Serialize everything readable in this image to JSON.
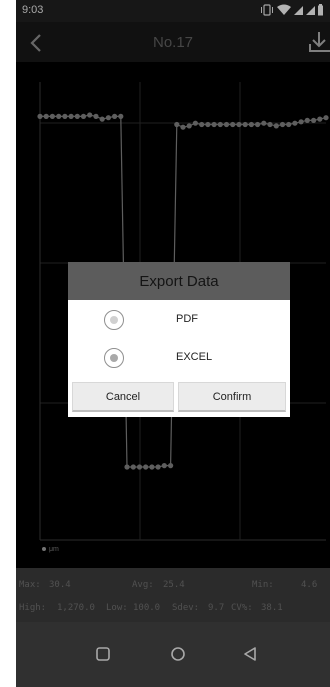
{
  "status_bar": {
    "time": "9:03",
    "icons": [
      "vibrate-icon",
      "wifi-icon",
      "cell-signal-icon",
      "cell-signal-icon",
      "battery-icon"
    ]
  },
  "header": {
    "title": "No.17",
    "back_icon": "chevron-left-icon",
    "action_icon": "download-icon"
  },
  "chart": {
    "legend": "μm",
    "colors": {
      "series": "#7e7e7e",
      "grid": "#2b2b2b",
      "axis": "#3a3a3a"
    }
  },
  "chart_data": {
    "type": "line",
    "title": "",
    "xlabel": "",
    "ylabel": "",
    "series": [
      {
        "name": "μm",
        "points": [
          [
            1,
            30.4
          ],
          [
            2,
            30.4
          ],
          [
            3,
            30.4
          ],
          [
            4,
            30.4
          ],
          [
            5,
            30.4
          ],
          [
            6,
            30.4
          ],
          [
            7,
            30.4
          ],
          [
            8,
            30.4
          ],
          [
            9,
            30.5
          ],
          [
            10,
            30.4
          ],
          [
            11,
            30.2
          ],
          [
            12,
            30.3
          ],
          [
            13,
            30.4
          ],
          [
            14,
            30.4
          ],
          [
            15,
            4.6
          ],
          [
            16,
            4.6
          ],
          [
            17,
            4.6
          ],
          [
            18,
            4.6
          ],
          [
            19,
            4.6
          ],
          [
            20,
            4.6
          ],
          [
            21,
            4.7
          ],
          [
            22,
            4.7
          ],
          [
            23,
            29.8
          ],
          [
            24,
            29.6
          ],
          [
            25,
            29.7
          ],
          [
            26,
            29.9
          ],
          [
            27,
            29.8
          ],
          [
            28,
            29.8
          ],
          [
            29,
            29.8
          ],
          [
            30,
            29.8
          ],
          [
            31,
            29.8
          ],
          [
            32,
            29.8
          ],
          [
            33,
            29.8
          ],
          [
            34,
            29.8
          ],
          [
            35,
            29.8
          ],
          [
            36,
            29.8
          ],
          [
            37,
            29.9
          ],
          [
            38,
            29.8
          ],
          [
            39,
            29.7
          ],
          [
            40,
            29.8
          ],
          [
            41,
            29.8
          ],
          [
            42,
            29.9
          ],
          [
            43,
            30.0
          ],
          [
            44,
            30.1
          ],
          [
            45,
            30.1
          ],
          [
            46,
            30.2
          ],
          [
            47,
            30.3
          ]
        ]
      }
    ]
  },
  "stats": {
    "max_label": "Max:",
    "max_value": "30.4",
    "avg_label": "Avg:",
    "avg_value": "25.4",
    "min_label": "Min:",
    "min_value": "4.6",
    "high_label": "High:",
    "high_value": "1,270.0",
    "low_label": "Low:",
    "low_value": "100.0",
    "sdev_label": "Sdev:",
    "sdev_value": "9.7",
    "cv_label": "CV%:",
    "cv_value": "38.1"
  },
  "dialog": {
    "title": "Export Data",
    "options": [
      {
        "label": "PDF",
        "selected": false
      },
      {
        "label": "EXCEL",
        "selected": true
      }
    ],
    "cancel_label": "Cancel",
    "confirm_label": "Confirm"
  },
  "nav_bar": {
    "icons": [
      "recents-square-icon",
      "home-circle-icon",
      "back-triangle-icon"
    ]
  }
}
